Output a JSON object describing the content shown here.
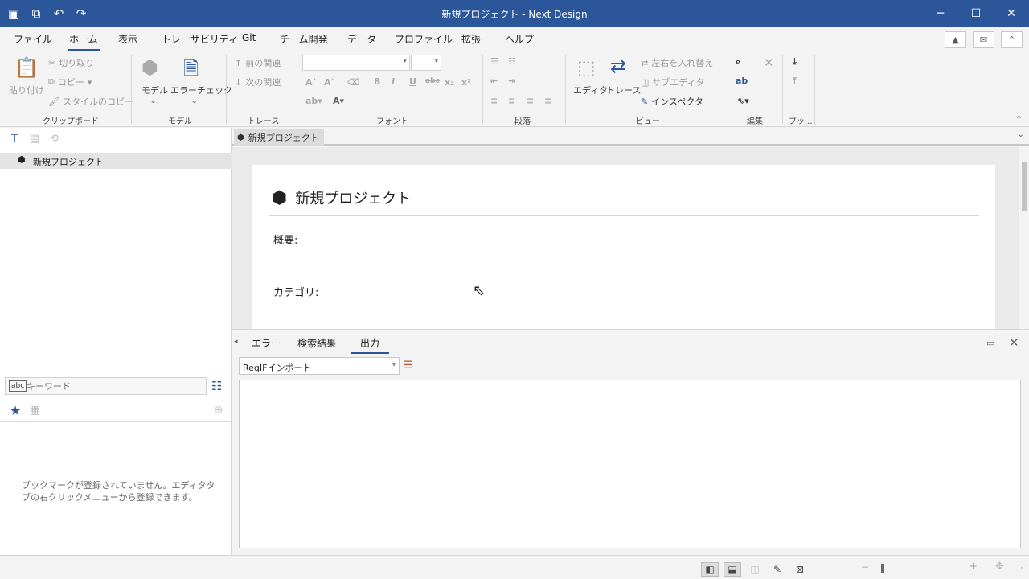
{
  "window": {
    "title": "新規プロジェクト - Next Design",
    "accent": "#2b579a"
  },
  "menu": {
    "tabs": [
      "ファイル",
      "ホーム",
      "表示",
      "トレーサビリティ",
      "Git",
      "チーム開発",
      "データ",
      "プロファイル",
      "拡張",
      "ヘルプ"
    ],
    "active": "ホーム"
  },
  "ribbon": {
    "clipboard": {
      "paste": "貼り付け",
      "cut": "切り取り",
      "copy": "コピー",
      "style_copy": "スタイルのコピー",
      "label": "クリップボード"
    },
    "model": {
      "model": "モデル",
      "error_check": "エラーチェック",
      "label": "モデル"
    },
    "trace": {
      "prev": "前の関連",
      "next": "次の関連",
      "label": "トレース"
    },
    "font": {
      "label": "フォント"
    },
    "paragraph": {
      "label": "段落"
    },
    "view": {
      "editor": "エディタ",
      "trace": "トレース",
      "swap": "左右を入れ替え",
      "sub_editor": "サブエディタ",
      "inspector": "インスペクタ",
      "label": "ビュー"
    },
    "edit": {
      "label": "編集"
    },
    "publish": {
      "label": "ブッ..."
    }
  },
  "left": {
    "tree_root": "新規プロジェクト",
    "search_placeholder": "キーワード",
    "bookmark_empty": "ブックマークが登録されていません。エディタタブの右クリックメニューから登録できます。"
  },
  "document": {
    "tab": "新規プロジェクト",
    "title": "新規プロジェクト",
    "fields": [
      "概要:",
      "カテゴリ:"
    ]
  },
  "output": {
    "tabs": [
      "エラー",
      "検索結果",
      "出力"
    ],
    "active": "出力",
    "source": "ReqIFインポート"
  }
}
